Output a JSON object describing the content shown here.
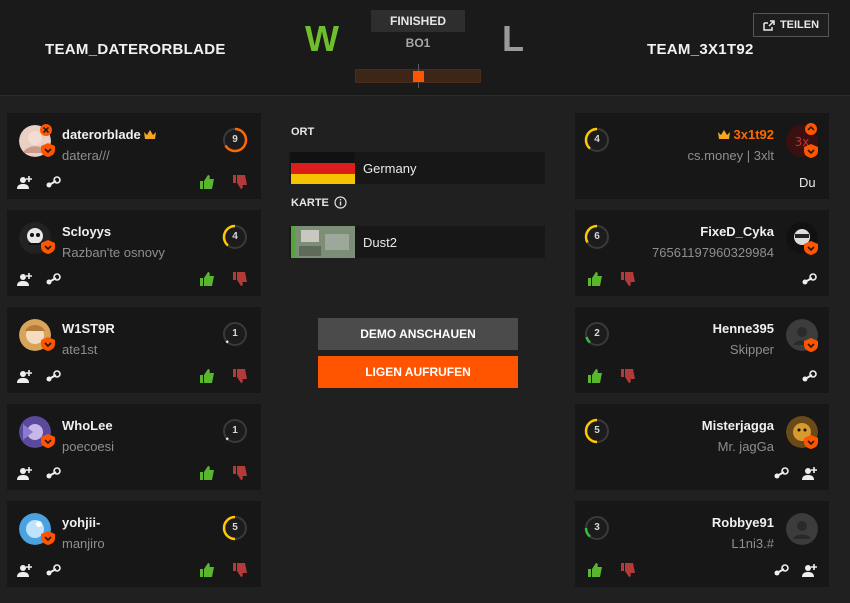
{
  "header": {
    "team_left": "TEAM_DATERORBLADE",
    "team_right": "TEAM_3X1T92",
    "result_left": "W",
    "result_right": "L",
    "status": "FINISHED",
    "format": "BO1",
    "share_label": "TEILEN",
    "accent": "#ff5500"
  },
  "match": {
    "location_label": "ORT",
    "location": "Germany",
    "map_label": "KARTE",
    "map": "Dust2",
    "demo_button": "DEMO ANSCHAUEN",
    "leagues_button": "LIGEN AUFRUFEN"
  },
  "team_left_players": [
    {
      "nick": "daterorblade",
      "sub": "datera///",
      "level": "9",
      "captain": true
    },
    {
      "nick": "Scloyys",
      "sub": "Razban'te osnovy",
      "level": "4"
    },
    {
      "nick": "W1ST9R",
      "sub": "ate1st",
      "level": "1"
    },
    {
      "nick": "WhoLee",
      "sub": "poecoesi",
      "level": "1"
    },
    {
      "nick": "yohjii-",
      "sub": "manjiro",
      "level": "5"
    }
  ],
  "team_right_players": [
    {
      "nick": "3x1t92",
      "sub": "cs.money | 3xlt",
      "level": "4",
      "captain": true,
      "note": "Du"
    },
    {
      "nick": "FixeD_Cyka",
      "sub": "76561197960329984",
      "level": "6"
    },
    {
      "nick": "Henne395",
      "sub": "Skipper",
      "level": "2"
    },
    {
      "nick": "Misterjagga",
      "sub": "Mr. jagGa",
      "level": "5"
    },
    {
      "nick": "Robbye91",
      "sub": "L1ni3.#",
      "level": "3"
    }
  ]
}
